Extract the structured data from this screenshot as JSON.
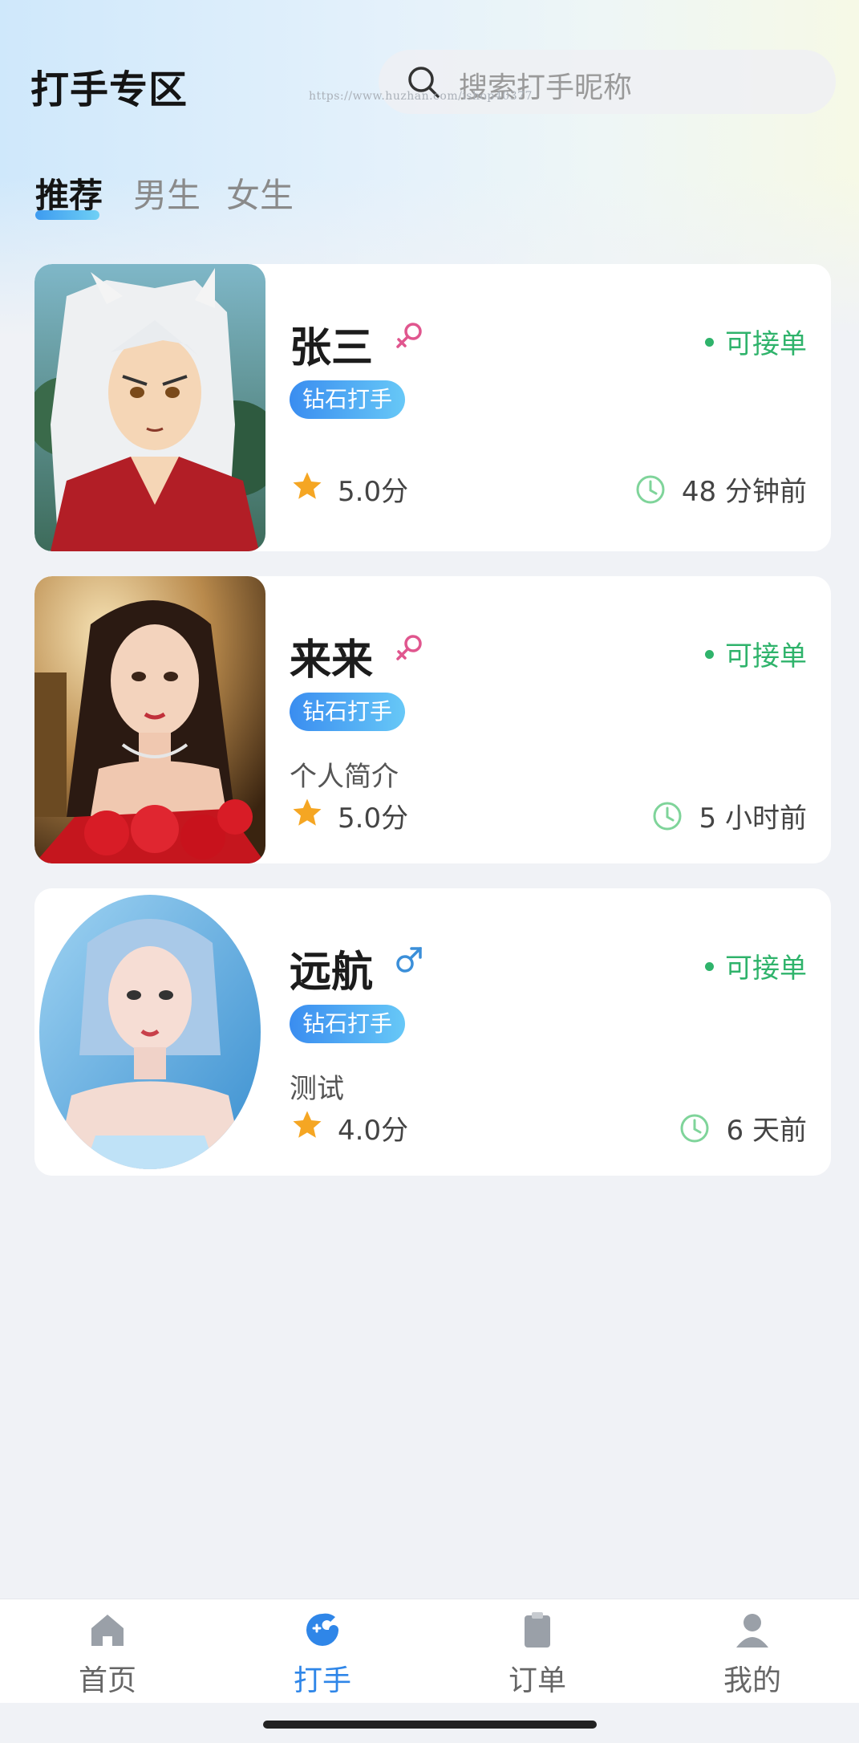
{
  "header": {
    "title": "打手专区",
    "search_placeholder": "搜索打手昵称",
    "watermark": "https://www.huzhan.com/ishop40377"
  },
  "tabs": [
    {
      "label": "推荐",
      "active": true
    },
    {
      "label": "男生",
      "active": false
    },
    {
      "label": "女生",
      "active": false
    }
  ],
  "players": [
    {
      "name": "张三",
      "gender": "female",
      "status": "可接单",
      "badge": "钻石打手",
      "bio": "",
      "rating": "5.0分",
      "last_active": "48 分钟前"
    },
    {
      "name": "来来",
      "gender": "female",
      "status": "可接单",
      "badge": "钻石打手",
      "bio": "个人简介",
      "rating": "5.0分",
      "last_active": "5 小时前"
    },
    {
      "name": "远航",
      "gender": "male",
      "status": "可接单",
      "badge": "钻石打手",
      "bio": "测试",
      "rating": "4.0分",
      "last_active": "6 天前"
    }
  ],
  "tabbar": [
    {
      "label": "首页",
      "icon": "home-icon",
      "active": false
    },
    {
      "label": "打手",
      "icon": "gamer-icon",
      "active": true
    },
    {
      "label": "订单",
      "icon": "clipboard-icon",
      "active": false
    },
    {
      "label": "我的",
      "icon": "user-icon",
      "active": false
    }
  ],
  "colors": {
    "accent": "#2f86e8",
    "status_green": "#2fb36b",
    "female_pink": "#e0568e",
    "male_blue": "#3b8fd9",
    "star_orange": "#f5a623"
  }
}
